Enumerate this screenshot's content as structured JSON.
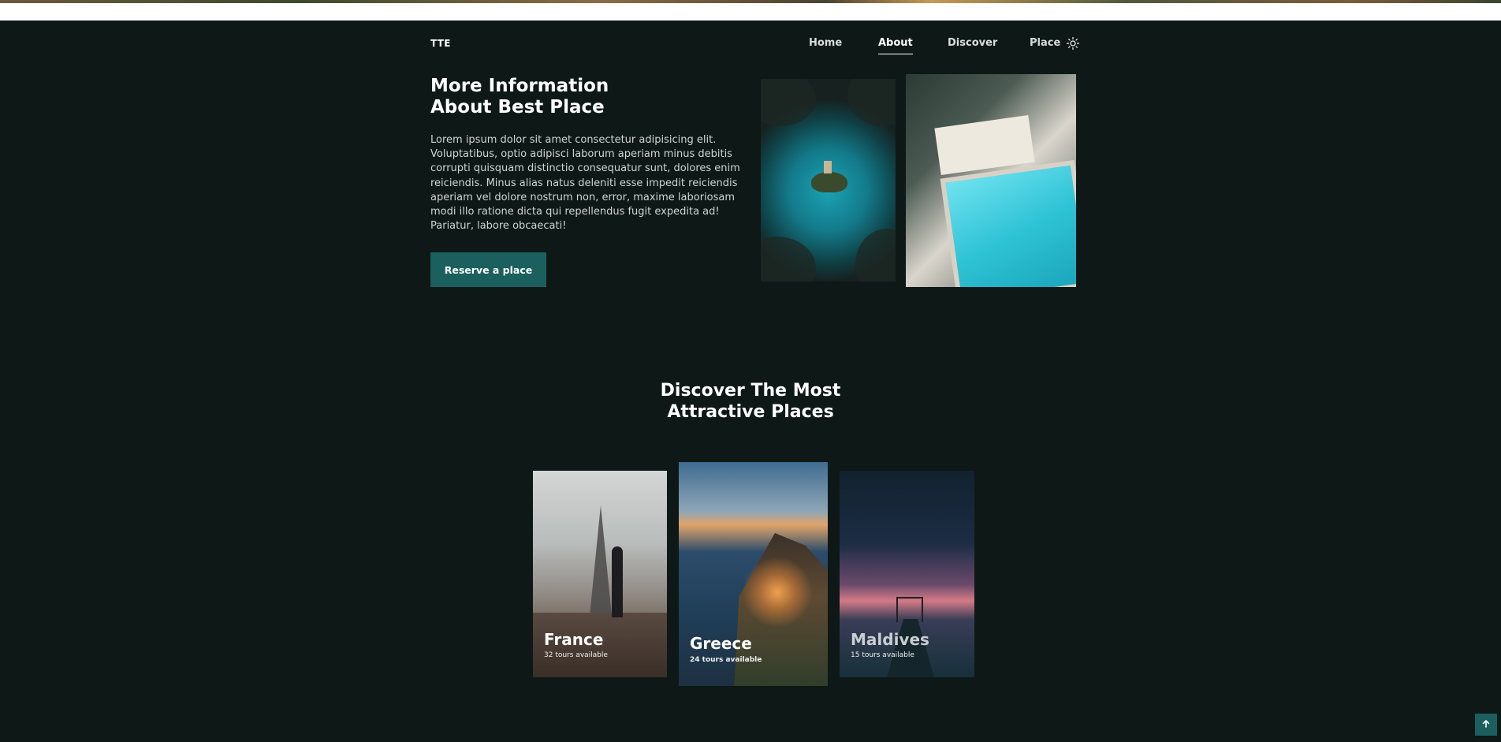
{
  "nav": {
    "logo": "TTE",
    "links": [
      {
        "label": "Home",
        "active": false
      },
      {
        "label": "About",
        "active": true
      },
      {
        "label": "Discover",
        "active": false
      },
      {
        "label": "Place",
        "active": false
      }
    ],
    "theme_icon": "sun-icon"
  },
  "about": {
    "title_line1": "More Information",
    "title_line2": "About Best Place",
    "text": "Lorem ipsum dolor sit amet consectetur adipisicing elit. Voluptatibus, optio adipisci laborum aperiam minus debitis corrupti quisquam distinctio consequatur sunt, dolores enim reiciendis. Minus alias natus deleniti esse impedit reiciendis aperiam vel dolore nostrum non, error, maxime laboriosam modi illo ratione dicta qui repellendus fugit expedita ad! Pariatur, labore obcaecati!",
    "button_label": "Reserve a place"
  },
  "discover": {
    "title_line1": "Discover The Most",
    "title_line2": "Attractive Places",
    "cards": [
      {
        "name": "France",
        "tours": "32 tours available"
      },
      {
        "name": "Greece",
        "tours": "24 tours available"
      },
      {
        "name": "Maldives",
        "tours": "15 tours available"
      }
    ]
  },
  "scroll_top_icon": "arrow-up-icon",
  "colors": {
    "background": "#0d1817",
    "accent": "#1b5f5e",
    "text": "#ffffff"
  }
}
